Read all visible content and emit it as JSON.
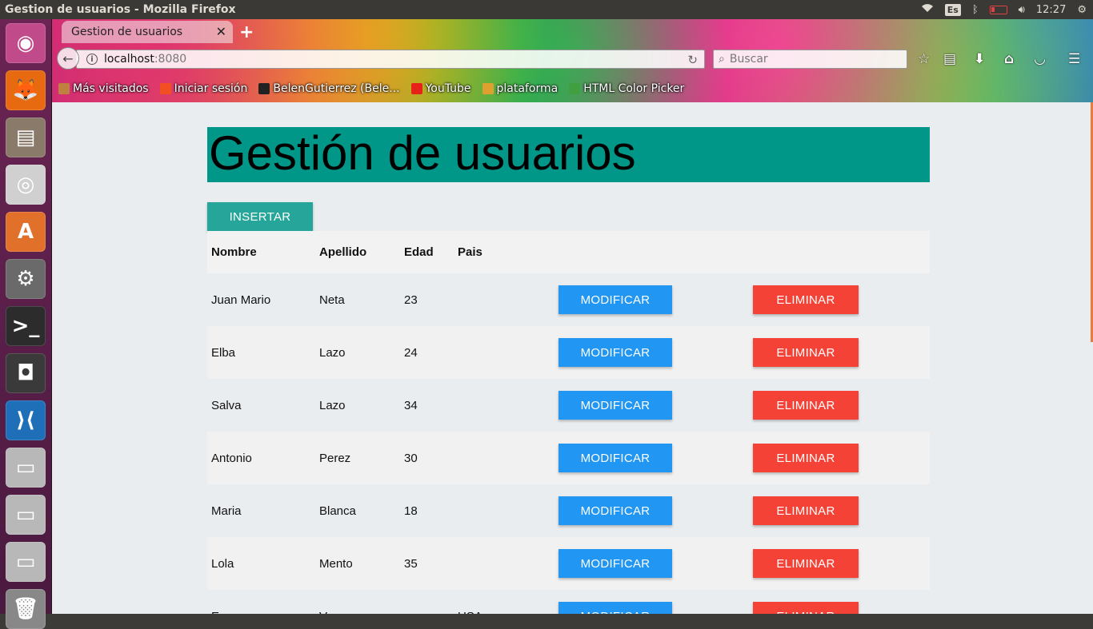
{
  "window": {
    "title": "Gestion de usuarios - Mozilla Firefox"
  },
  "panel": {
    "keyboard": "Es",
    "time": "12:27"
  },
  "launcher": {
    "items": [
      {
        "name": "ubuntu-dash",
        "color": "#c04a8a",
        "glyph": "◉"
      },
      {
        "name": "firefox",
        "color": "#e86a10",
        "glyph": "🦊"
      },
      {
        "name": "files",
        "color": "#8a7a6a",
        "glyph": "▤"
      },
      {
        "name": "chrome",
        "color": "#d0d0d0",
        "glyph": "◎"
      },
      {
        "name": "software-center",
        "color": "#e0702a",
        "glyph": "A"
      },
      {
        "name": "system-settings",
        "color": "#6a6a6a",
        "glyph": "⚙"
      },
      {
        "name": "terminal",
        "color": "#2c2c2c",
        "glyph": ">_"
      },
      {
        "name": "disk",
        "color": "#3a3a3a",
        "glyph": "◘"
      },
      {
        "name": "vscode",
        "color": "#1e6fb8",
        "glyph": "⟩⟨"
      },
      {
        "name": "drive-1",
        "color": "#b8b8b8",
        "glyph": "▭"
      },
      {
        "name": "drive-2",
        "color": "#b8b8b8",
        "glyph": "▭"
      },
      {
        "name": "drive-3",
        "color": "#b8b8b8",
        "glyph": "▭"
      },
      {
        "name": "trash",
        "color": "#888888",
        "glyph": "🗑"
      }
    ]
  },
  "browser": {
    "tab_title": "Gestion de usuarios",
    "url_host": "localhost",
    "url_port": ":8080",
    "search_placeholder": "Buscar",
    "bookmarks": [
      {
        "label": "Más visitados",
        "icon_color": "#c08040"
      },
      {
        "label": "Iniciar sesión",
        "icon_color": "#f25022"
      },
      {
        "label": "BelenGutierrez (Bele...",
        "icon_color": "#222222"
      },
      {
        "label": "YouTube",
        "icon_color": "#e62117"
      },
      {
        "label": "plataforma",
        "icon_color": "#e0a030"
      },
      {
        "label": "HTML Color Picker",
        "icon_color": "#40a040"
      }
    ]
  },
  "page": {
    "title": "Gestión de usuarios",
    "insert_label": "INSERTAR",
    "columns": {
      "nombre": "Nombre",
      "apellido": "Apellido",
      "edad": "Edad",
      "pais": "Pais"
    },
    "modify_label": "MODIFICAR",
    "delete_label": "ELIMINAR",
    "users": [
      {
        "nombre": "Juan Mario",
        "apellido": "Neta",
        "edad": "23",
        "pais": ""
      },
      {
        "nombre": "Elba",
        "apellido": "Lazo",
        "edad": "24",
        "pais": ""
      },
      {
        "nombre": "Salva",
        "apellido": "Lazo",
        "edad": "34",
        "pais": ""
      },
      {
        "nombre": "Antonio",
        "apellido": "Perez",
        "edad": "30",
        "pais": ""
      },
      {
        "nombre": "Maria",
        "apellido": "Blanca",
        "edad": "18",
        "pais": ""
      },
      {
        "nombre": "Lola",
        "apellido": "Mento",
        "edad": "35",
        "pais": ""
      },
      {
        "nombre": "E",
        "apellido": "V",
        "edad": "",
        "pais": "USA"
      }
    ]
  },
  "colors": {
    "header": "#009688",
    "insert": "#26a69a",
    "modify": "#2196f3",
    "delete": "#f44336"
  }
}
